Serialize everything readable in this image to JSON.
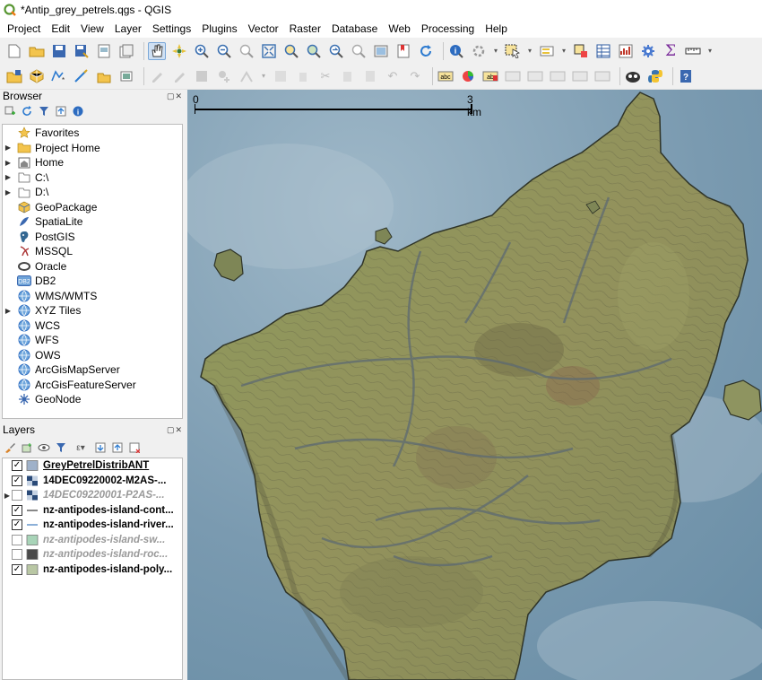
{
  "window": {
    "title": "*Antip_grey_petrels.qgs - QGIS"
  },
  "menu": [
    "Project",
    "Edit",
    "View",
    "Layer",
    "Settings",
    "Plugins",
    "Vector",
    "Raster",
    "Database",
    "Web",
    "Processing",
    "Help"
  ],
  "browser": {
    "title": "Browser",
    "items": [
      {
        "label": "Favorites",
        "icon": "star-icon",
        "expandable": false
      },
      {
        "label": "Project Home",
        "icon": "folder-icon",
        "expandable": true
      },
      {
        "label": "Home",
        "icon": "home-folder-icon",
        "expandable": true
      },
      {
        "label": "C:\\",
        "icon": "drive-icon",
        "expandable": true
      },
      {
        "label": "D:\\",
        "icon": "drive-icon",
        "expandable": true
      },
      {
        "label": "GeoPackage",
        "icon": "geopackage-icon",
        "expandable": false
      },
      {
        "label": "SpatiaLite",
        "icon": "spatialite-icon",
        "expandable": false
      },
      {
        "label": "PostGIS",
        "icon": "postgis-icon",
        "expandable": false
      },
      {
        "label": "MSSQL",
        "icon": "mssql-icon",
        "expandable": false
      },
      {
        "label": "Oracle",
        "icon": "oracle-icon",
        "expandable": false
      },
      {
        "label": "DB2",
        "icon": "db2-icon",
        "expandable": false
      },
      {
        "label": "WMS/WMTS",
        "icon": "globe-icon",
        "expandable": false
      },
      {
        "label": "XYZ Tiles",
        "icon": "globe-icon",
        "expandable": true
      },
      {
        "label": "WCS",
        "icon": "globe-icon",
        "expandable": false
      },
      {
        "label": "WFS",
        "icon": "globe-icon",
        "expandable": false
      },
      {
        "label": "OWS",
        "icon": "globe-icon",
        "expandable": false
      },
      {
        "label": "ArcGisMapServer",
        "icon": "globe-icon",
        "expandable": false
      },
      {
        "label": "ArcGisFeatureServer",
        "icon": "globe-icon",
        "expandable": false
      },
      {
        "label": "GeoNode",
        "icon": "geonode-icon",
        "expandable": false
      }
    ],
    "db2_badge": "DB2"
  },
  "layers": {
    "title": "Layers",
    "items": [
      {
        "label": "GreyPetrelDistribANT",
        "checked": true,
        "visible": true,
        "underline": true,
        "symbol": "polygon",
        "color": "#9fb1c9",
        "expandable": false
      },
      {
        "label": "14DEC09220002-M2AS-...",
        "checked": true,
        "visible": true,
        "symbol": "raster",
        "color": "#2a4a78",
        "expandable": false
      },
      {
        "label": "14DEC09220001-P2AS-...",
        "checked": false,
        "visible": false,
        "symbol": "raster",
        "color": "#2a4a78",
        "expandable": true
      },
      {
        "label": "nz-antipodes-island-cont...",
        "checked": true,
        "visible": true,
        "symbol": "line",
        "color": "#555555",
        "expandable": false
      },
      {
        "label": "nz-antipodes-island-river...",
        "checked": true,
        "visible": true,
        "symbol": "line",
        "color": "#5a8fc8",
        "expandable": false
      },
      {
        "label": "nz-antipodes-island-sw...",
        "checked": false,
        "visible": false,
        "symbol": "polygon",
        "color": "#a8d4b8",
        "expandable": false
      },
      {
        "label": "nz-antipodes-island-roc...",
        "checked": false,
        "visible": false,
        "symbol": "polygon",
        "color": "#4a4a4a",
        "expandable": false
      },
      {
        "label": "nz-antipodes-island-poly...",
        "checked": true,
        "visible": true,
        "symbol": "polygon",
        "color": "#b9c7a4",
        "expandable": false
      }
    ]
  },
  "scalebar": {
    "start": "0",
    "end": "3 km"
  },
  "colors": {
    "sea": "#7d9cb2",
    "land": "#8e9460",
    "land_dark": "#6f7a48",
    "contour": "#4a4a3a",
    "river": "#6a7a8a"
  }
}
